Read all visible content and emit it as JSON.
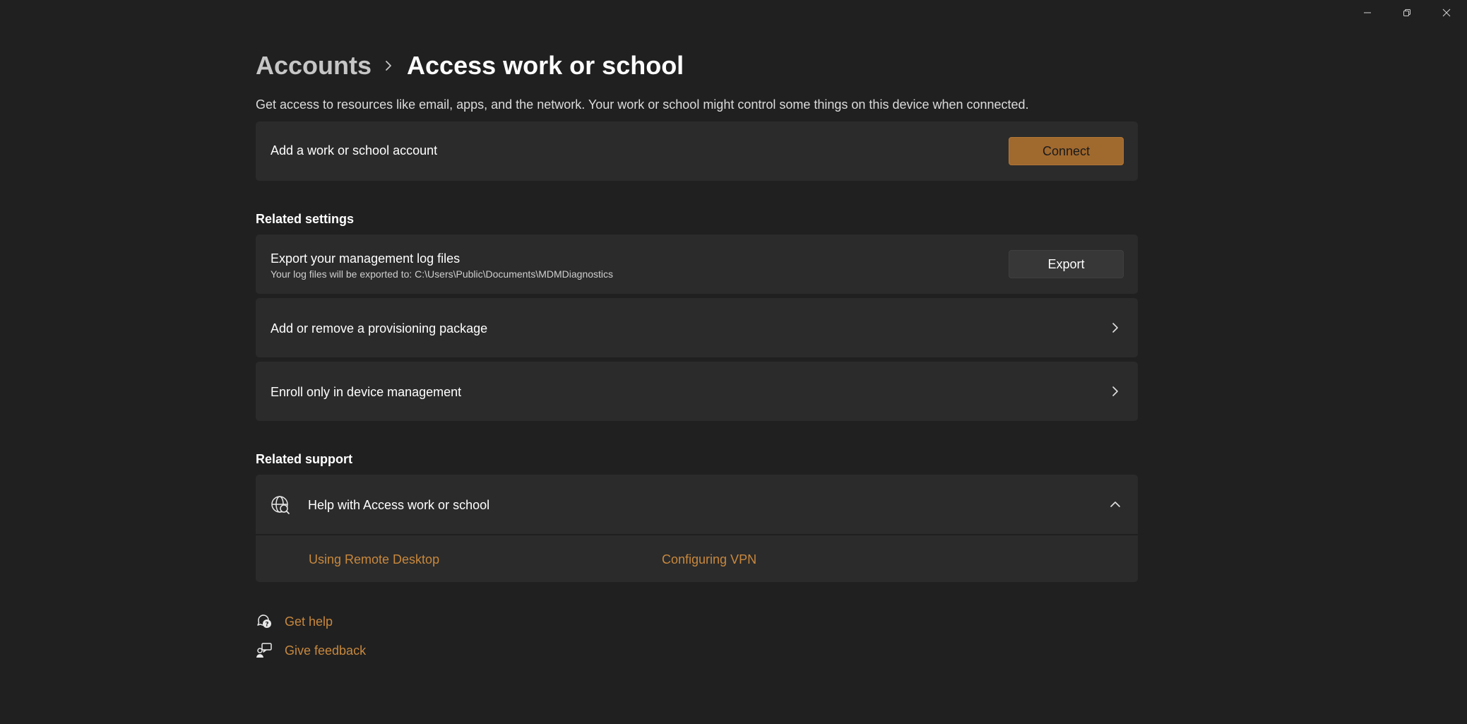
{
  "window": {
    "controls": {
      "minimize_icon": "minimize-icon",
      "maximize_icon": "restore-icon",
      "close_icon": "close-icon"
    }
  },
  "breadcrumb": {
    "parent": "Accounts",
    "separator_icon": "chevron-right-icon",
    "current": "Access work or school"
  },
  "description": "Get access to resources like email, apps, and the network. Your work or school might control some things on this device when connected.",
  "add_account": {
    "title": "Add a work or school account",
    "button_label": "Connect"
  },
  "related_settings": {
    "header": "Related settings",
    "export": {
      "title": "Export your management log files",
      "subtitle": "Your log files will be exported to: C:\\Users\\Public\\Documents\\MDMDiagnostics",
      "button_label": "Export"
    },
    "provisioning": {
      "title": "Add or remove a provisioning package"
    },
    "enroll": {
      "title": "Enroll only in device management"
    }
  },
  "related_support": {
    "header": "Related support",
    "help": {
      "icon": "globe-search-icon",
      "title": "Help with Access work or school",
      "expanded": true,
      "links": [
        "Using Remote Desktop",
        "Configuring VPN"
      ]
    }
  },
  "footer": {
    "get_help": "Get help",
    "give_feedback": "Give feedback"
  },
  "colors": {
    "background": "#202020",
    "card": "#2b2b2b",
    "accent": "#a0692e",
    "link": "#c8883d"
  }
}
